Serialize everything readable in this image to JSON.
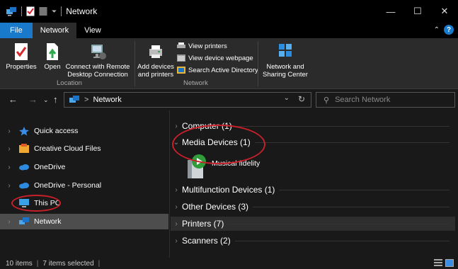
{
  "window": {
    "title": "Network",
    "controls": {
      "minimize": "—",
      "maximize": "☐",
      "close": "✕"
    }
  },
  "ribbon_tabs": [
    {
      "label": "File"
    },
    {
      "label": "Network"
    },
    {
      "label": "View"
    }
  ],
  "ribbon": {
    "location_group": {
      "label": "Location",
      "buttons": [
        {
          "label": "Properties"
        },
        {
          "label": "Open"
        },
        {
          "label": "Connect with Remote Desktop Connection"
        }
      ]
    },
    "network_group": {
      "label": "Network",
      "add_devices": "Add devices and printers",
      "view_printers": "View printers",
      "view_device_webpage": "View device webpage",
      "search_ad": "Search Active Directory",
      "network_sharing": "Network and Sharing Center"
    }
  },
  "address": {
    "path": "Network",
    "separator": ">",
    "search_placeholder": "Search Network"
  },
  "nav_pane": {
    "items": [
      {
        "label": "Quick access",
        "icon": "star-icon"
      },
      {
        "label": "Creative Cloud Files",
        "icon": "creative-cloud-icon"
      },
      {
        "label": "OneDrive",
        "icon": "cloud-icon"
      },
      {
        "label": "OneDrive - Personal",
        "icon": "cloud-icon"
      },
      {
        "label": "This PC",
        "icon": "monitor-icon"
      },
      {
        "label": "Network",
        "icon": "network-icon",
        "selected": true
      }
    ]
  },
  "content": {
    "groups": [
      {
        "label": "Computer (1)",
        "collapsed": true
      },
      {
        "label": "Media Devices (1)",
        "collapsed": false
      },
      {
        "label": "Multifunction Devices (1)",
        "collapsed": true
      },
      {
        "label": "Other Devices (3)",
        "collapsed": true
      },
      {
        "label": "Printers (7)",
        "collapsed": true
      },
      {
        "label": "Scanners (2)",
        "collapsed": true
      }
    ],
    "media_device": {
      "label": "Musical fidelity"
    }
  },
  "status_bar": {
    "items_count": "10 items",
    "selected": "7 items selected"
  },
  "colors": {
    "accent": "#1979ca",
    "annotation": "#c8202a",
    "background": "#191919"
  }
}
